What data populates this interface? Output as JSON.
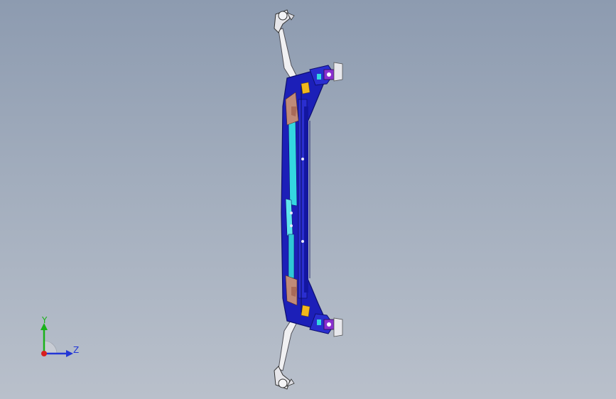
{
  "viewport": {
    "background_top": "#8d9bb0",
    "background_bottom": "#b9c0cb"
  },
  "model": {
    "description_icon": "subframe-crossmember-model",
    "colors": {
      "frame": "#1c1fb8",
      "frame_dark": "#0d0f6e",
      "highlight": "#34d7e0",
      "bracket": "#c08a78",
      "bushing": "#e8e8ec",
      "mount": "#8a2fd0",
      "accent": "#f2b81c",
      "arm": "#f0f0f2"
    }
  },
  "triad": {
    "y_label": "Y",
    "z_label": "Z",
    "y_color": "#19b219",
    "z_color": "#2337d6",
    "x_color": "#d81f1f"
  }
}
